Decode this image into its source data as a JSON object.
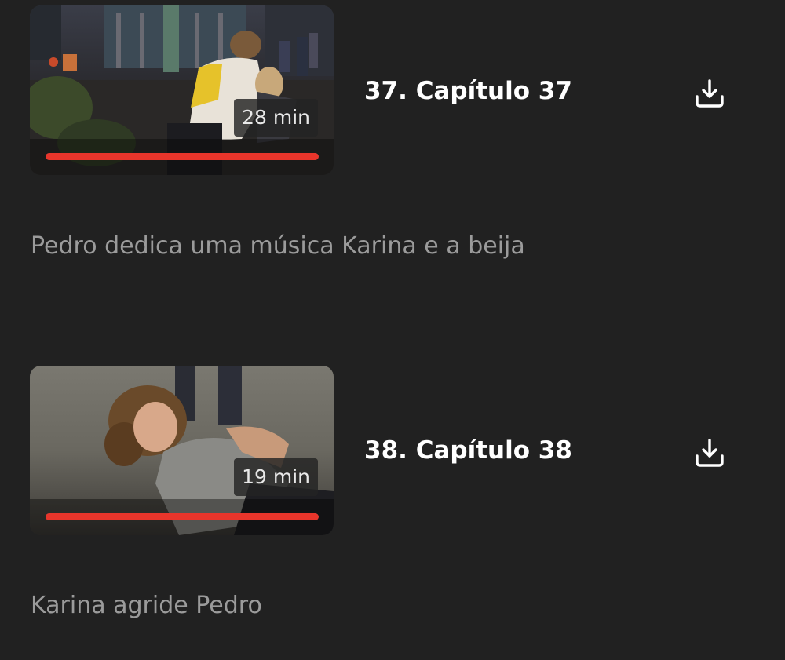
{
  "episodes": [
    {
      "title": "37. Capítulo 37",
      "duration": "28 min",
      "description": "Pedro dedica uma música Karina e a beija",
      "progress_percent": 100,
      "thumbnail_icon": "episode-37-thumbnail",
      "download_icon": "download-icon"
    },
    {
      "title": "38. Capítulo 38",
      "duration": "19 min",
      "description": "Karina agride Pedro",
      "progress_percent": 100,
      "thumbnail_icon": "episode-38-thumbnail",
      "download_icon": "download-icon"
    }
  ],
  "colors": {
    "background": "#212121",
    "title": "#ffffff",
    "description": "#9b9b9b",
    "progress": "#e8352b"
  }
}
